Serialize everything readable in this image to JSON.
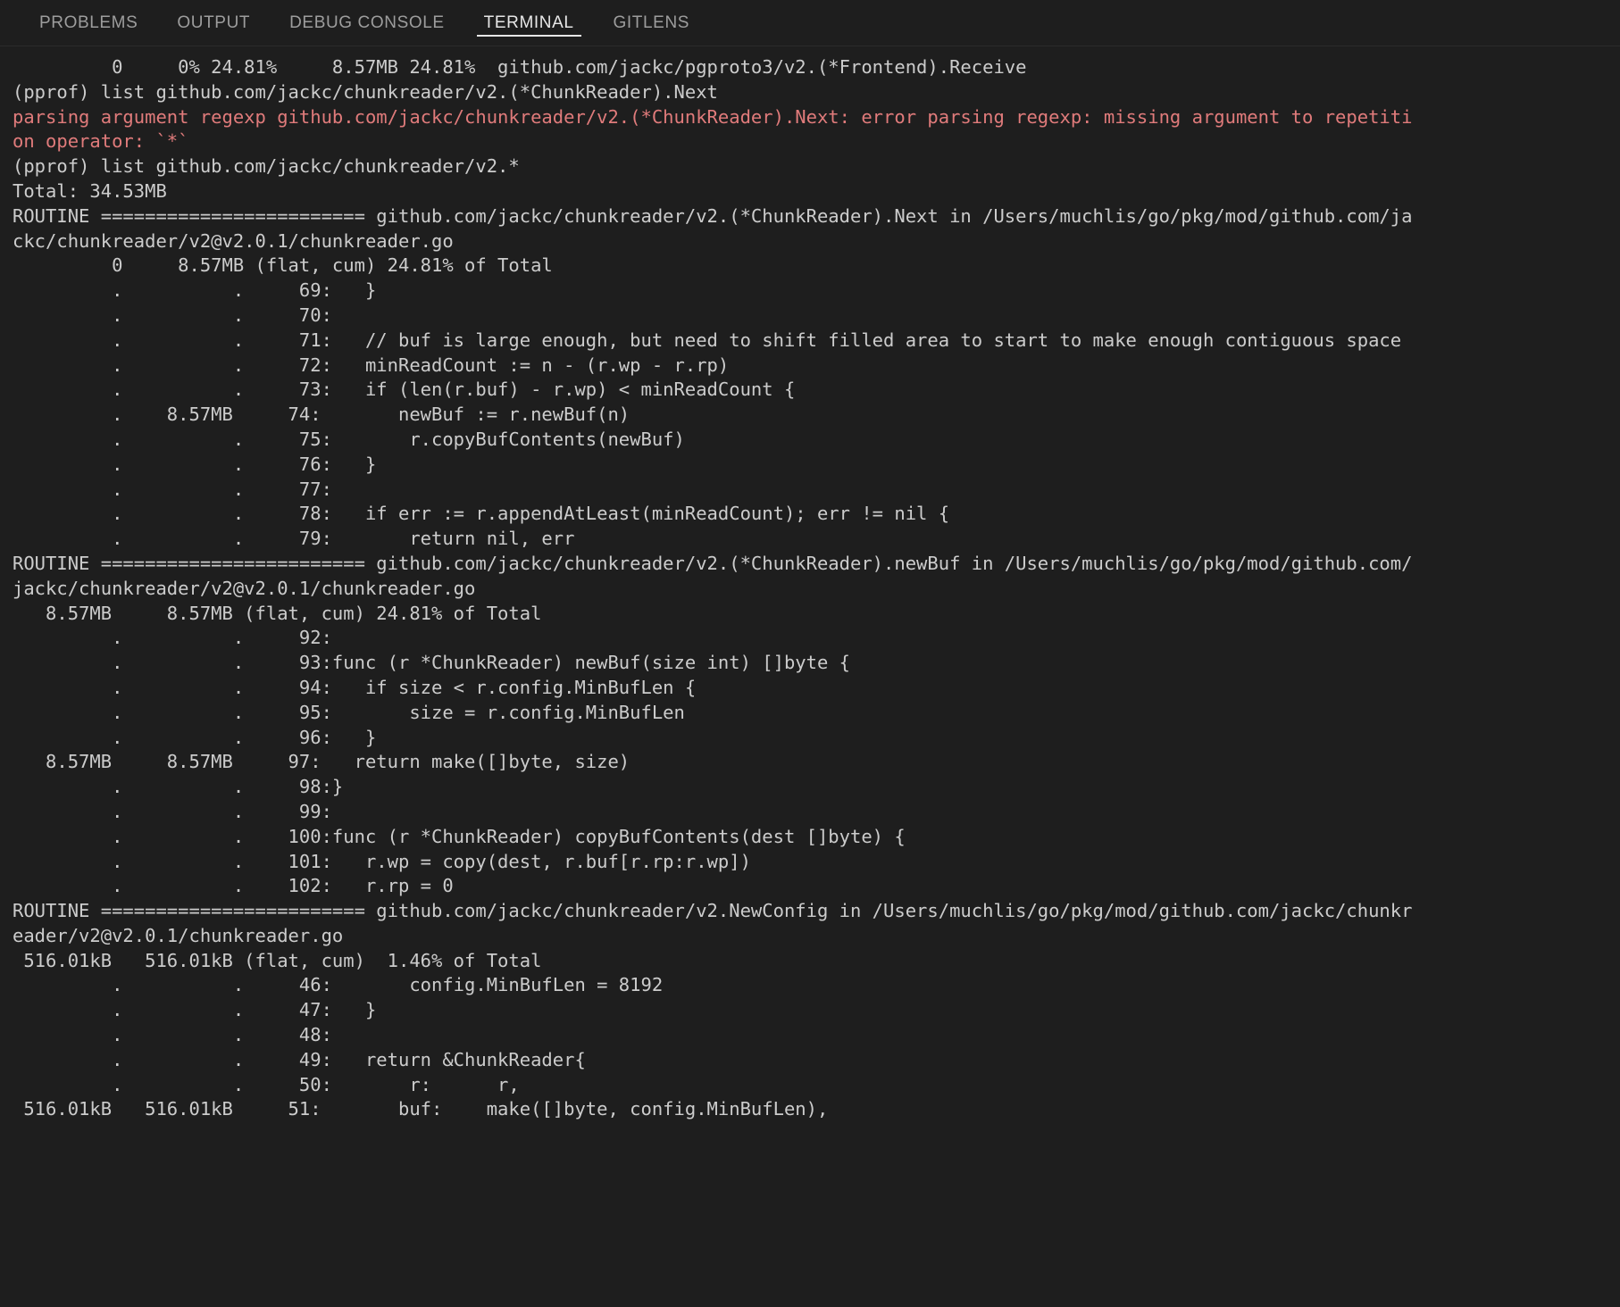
{
  "panel": {
    "tabs": [
      {
        "label": "PROBLEMS",
        "active": false
      },
      {
        "label": "OUTPUT",
        "active": false
      },
      {
        "label": "DEBUG CONSOLE",
        "active": false
      },
      {
        "label": "TERMINAL",
        "active": true
      },
      {
        "label": "GITLENS",
        "active": false
      }
    ]
  },
  "terminal": {
    "colors": {
      "background": "#1e1e1e",
      "foreground": "#cccccc",
      "error": "#e07b7b",
      "tab_active": "#e7e7e7",
      "tab_inactive": "#9d9d9d"
    },
    "lines": [
      {
        "text": "         0     0% 24.81%     8.57MB 24.81%  github.com/jackc/pgproto3/v2.(*Frontend).Receive",
        "kind": "normal"
      },
      {
        "text": "(pprof) list github.com/jackc/chunkreader/v2.(*ChunkReader).Next",
        "kind": "normal"
      },
      {
        "text": "parsing argument regexp github.com/jackc/chunkreader/v2.(*ChunkReader).Next: error parsing regexp: missing argument to repetiti",
        "kind": "error"
      },
      {
        "text": "on operator: `*`",
        "kind": "error"
      },
      {
        "text": "(pprof) list github.com/jackc/chunkreader/v2.*",
        "kind": "normal"
      },
      {
        "text": "Total: 34.53MB",
        "kind": "normal"
      },
      {
        "text": "ROUTINE ======================== github.com/jackc/chunkreader/v2.(*ChunkReader).Next in /Users/muchlis/go/pkg/mod/github.com/ja",
        "kind": "normal"
      },
      {
        "text": "ckc/chunkreader/v2@v2.0.1/chunkreader.go",
        "kind": "normal"
      },
      {
        "text": "         0     8.57MB (flat, cum) 24.81% of Total",
        "kind": "normal"
      },
      {
        "text": "         .          .     69:   }",
        "kind": "normal"
      },
      {
        "text": "         .          .     70:",
        "kind": "normal"
      },
      {
        "text": "         .          .     71:   // buf is large enough, but need to shift filled area to start to make enough contiguous space",
        "kind": "normal"
      },
      {
        "text": "         .          .     72:   minReadCount := n - (r.wp - r.rp)",
        "kind": "normal"
      },
      {
        "text": "         .          .     73:   if (len(r.buf) - r.wp) < minReadCount {",
        "kind": "normal"
      },
      {
        "text": "         .    8.57MB     74:       newBuf := r.newBuf(n)",
        "kind": "normal"
      },
      {
        "text": "         .          .     75:       r.copyBufContents(newBuf)",
        "kind": "normal"
      },
      {
        "text": "         .          .     76:   }",
        "kind": "normal"
      },
      {
        "text": "         .          .     77:",
        "kind": "normal"
      },
      {
        "text": "         .          .     78:   if err := r.appendAtLeast(minReadCount); err != nil {",
        "kind": "normal"
      },
      {
        "text": "         .          .     79:       return nil, err",
        "kind": "normal"
      },
      {
        "text": "ROUTINE ======================== github.com/jackc/chunkreader/v2.(*ChunkReader).newBuf in /Users/muchlis/go/pkg/mod/github.com/",
        "kind": "normal"
      },
      {
        "text": "jackc/chunkreader/v2@v2.0.1/chunkreader.go",
        "kind": "normal"
      },
      {
        "text": "   8.57MB     8.57MB (flat, cum) 24.81% of Total",
        "kind": "normal"
      },
      {
        "text": "         .          .     92:",
        "kind": "normal"
      },
      {
        "text": "         .          .     93:func (r *ChunkReader) newBuf(size int) []byte {",
        "kind": "normal"
      },
      {
        "text": "         .          .     94:   if size < r.config.MinBufLen {",
        "kind": "normal"
      },
      {
        "text": "         .          .     95:       size = r.config.MinBufLen",
        "kind": "normal"
      },
      {
        "text": "         .          .     96:   }",
        "kind": "normal"
      },
      {
        "text": "   8.57MB     8.57MB     97:   return make([]byte, size)",
        "kind": "normal"
      },
      {
        "text": "         .          .     98:}",
        "kind": "normal"
      },
      {
        "text": "         .          .     99:",
        "kind": "normal"
      },
      {
        "text": "         .          .    100:func (r *ChunkReader) copyBufContents(dest []byte) {",
        "kind": "normal"
      },
      {
        "text": "         .          .    101:   r.wp = copy(dest, r.buf[r.rp:r.wp])",
        "kind": "normal"
      },
      {
        "text": "         .          .    102:   r.rp = 0",
        "kind": "normal"
      },
      {
        "text": "ROUTINE ======================== github.com/jackc/chunkreader/v2.NewConfig in /Users/muchlis/go/pkg/mod/github.com/jackc/chunkr",
        "kind": "normal"
      },
      {
        "text": "eader/v2@v2.0.1/chunkreader.go",
        "kind": "normal"
      },
      {
        "text": " 516.01kB   516.01kB (flat, cum)  1.46% of Total",
        "kind": "normal"
      },
      {
        "text": "         .          .     46:       config.MinBufLen = 8192",
        "kind": "normal"
      },
      {
        "text": "         .          .     47:   }",
        "kind": "normal"
      },
      {
        "text": "         .          .     48:",
        "kind": "normal"
      },
      {
        "text": "         .          .     49:   return &ChunkReader{",
        "kind": "normal"
      },
      {
        "text": "         .          .     50:       r:      r,",
        "kind": "normal"
      },
      {
        "text": " 516.01kB   516.01kB     51:       buf:    make([]byte, config.MinBufLen),",
        "kind": "normal"
      }
    ]
  }
}
